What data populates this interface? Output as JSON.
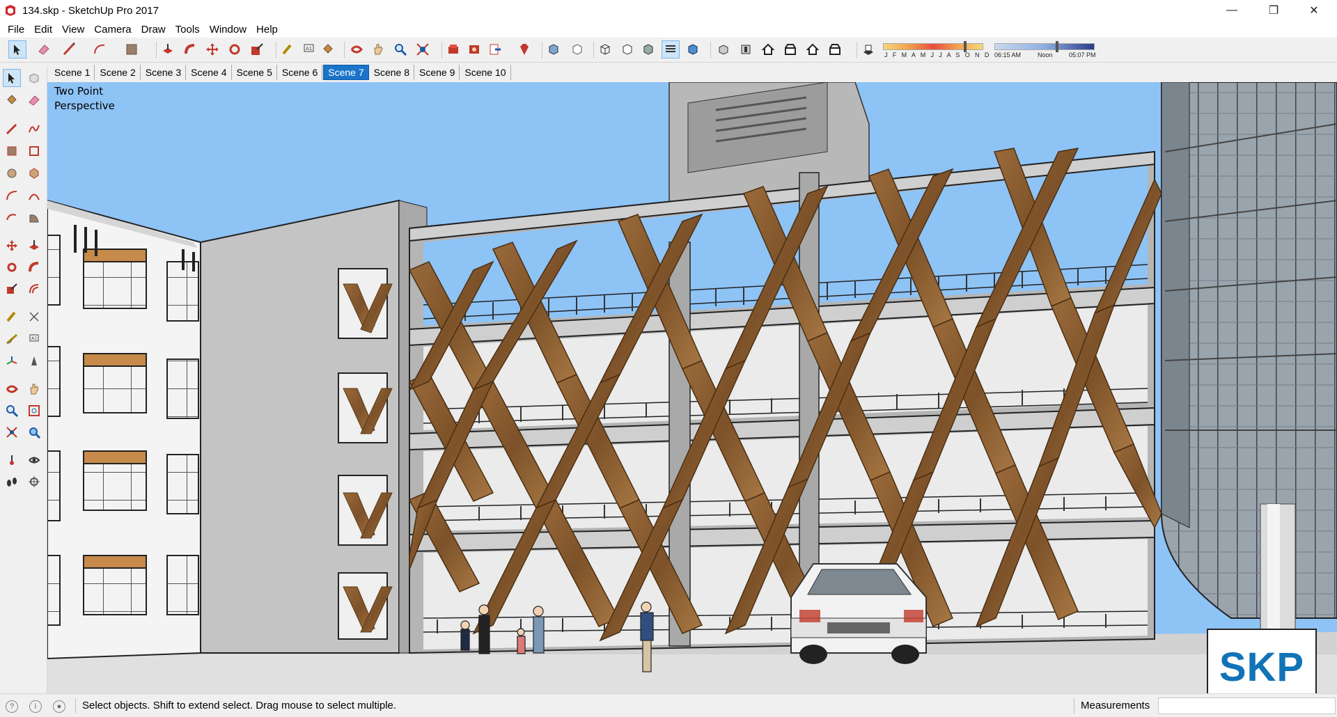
{
  "window": {
    "title": "134.skp - SketchUp Pro 2017",
    "minimize_icon": "minimize-icon",
    "maximize_icon": "restore-icon",
    "close_icon": "close-icon"
  },
  "menu": [
    "File",
    "Edit",
    "View",
    "Camera",
    "Draw",
    "Tools",
    "Window",
    "Help"
  ],
  "toolbar": {
    "tools": [
      "select",
      "eraser",
      "line",
      "arc",
      "shapes",
      "push-pull",
      "follow-me",
      "move",
      "rotate",
      "scale",
      "tape-measure",
      "text",
      "paint-bucket",
      "orbit",
      "pan",
      "zoom",
      "zoom-extents",
      "3d-warehouse",
      "extension-warehouse",
      "layout",
      "ruby",
      "xray",
      "back-edges",
      "wireframe",
      "hidden-line",
      "shaded",
      "shaded-textures",
      "monochrome",
      "iso",
      "top",
      "front",
      "right",
      "back",
      "left",
      "shadows"
    ],
    "shadow_months": "J F M A M J J A S O N D",
    "shadow_time_start": "06:15 AM",
    "shadow_time_mid": "Noon",
    "shadow_time_end": "05:07 PM"
  },
  "scenes": {
    "tabs": [
      "Scene 1",
      "Scene 2",
      "Scene 3",
      "Scene 4",
      "Scene 5",
      "Scene 6",
      "Scene 7",
      "Scene 8",
      "Scene 9",
      "Scene 10"
    ],
    "selected_index": 6
  },
  "viewport": {
    "camera_line1": "Two Point",
    "camera_line2": "Perspective",
    "badge": "SKP"
  },
  "status": {
    "message": "Select objects. Shift to extend select. Drag mouse to select multiple.",
    "measurements_label": "Measurements",
    "measurements_value": ""
  },
  "colors": {
    "sky": "#8ec3f6",
    "wood": "#8b5a2b",
    "selected_tab": "#1a74c9",
    "badge_text": "#1173b8"
  }
}
